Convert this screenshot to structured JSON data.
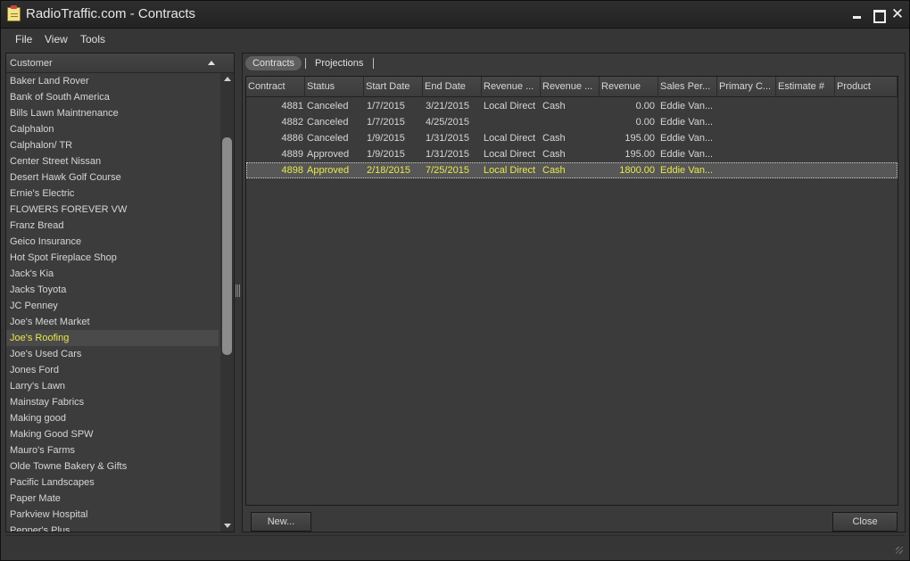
{
  "window": {
    "title": "RadioTraffic.com - Contracts"
  },
  "menu": {
    "file": "File",
    "view": "View",
    "tools": "Tools"
  },
  "customers": {
    "header": "Customer",
    "selected_index": 16,
    "items": [
      "Baker Land Rover",
      "Bank of South America",
      "Bills Lawn Maintnenance",
      "Calphalon",
      "Calphalon/ TR",
      "Center Street Nissan",
      "Desert Hawk Golf Course",
      "Ernie's Electric",
      "FLOWERS FOREVER  VW",
      "Franz Bread",
      "Geico Insurance",
      "Hot Spot Fireplace Shop",
      "Jack's Kia",
      "Jacks Toyota",
      "JC Penney",
      "Joe's Meet Market",
      "Joe's Roofing",
      "Joe's Used Cars",
      "Jones Ford",
      "Larry's Lawn",
      "Mainstay Fabrics",
      "Making good",
      "Making Good SPW",
      "Mauro's Farms",
      "Olde Towne Bakery & Gifts",
      "Pacific Landscapes",
      "Paper Mate",
      "Parkview Hospital",
      "Pepper's Plus"
    ]
  },
  "tabs": {
    "contracts": "Contracts",
    "projections": "Projections"
  },
  "grid": {
    "columns": [
      "Contract",
      "Status",
      "Start Date",
      "End Date",
      "Revenue ...",
      "Revenue ...",
      "Revenue",
      "Sales Per...",
      "Primary C...",
      "Estimate #",
      "Product"
    ],
    "selected_index": 4,
    "rows": [
      [
        "4881",
        "Canceled",
        "1/7/2015",
        "3/21/2015",
        "Local Direct",
        "Cash",
        "0.00",
        "Eddie Van...",
        "",
        "",
        ""
      ],
      [
        "4882",
        "Canceled",
        "1/7/2015",
        "4/25/2015",
        "",
        "",
        "0.00",
        "Eddie Van...",
        "",
        "",
        ""
      ],
      [
        "4886",
        "Canceled",
        "1/9/2015",
        "1/31/2015",
        "Local Direct",
        "Cash",
        "195.00",
        "Eddie Van...",
        "",
        "",
        ""
      ],
      [
        "4889",
        "Approved",
        "1/9/2015",
        "1/31/2015",
        "Local Direct",
        "Cash",
        "195.00",
        "Eddie Van...",
        "",
        "",
        ""
      ],
      [
        "4898",
        "Approved",
        "2/18/2015",
        "7/25/2015",
        "Local Direct",
        "Cash",
        "1800.00",
        "Eddie Van...",
        "",
        "",
        ""
      ]
    ]
  },
  "buttons": {
    "new": "New...",
    "close": "Close"
  },
  "colors": {
    "selected_text": "#e8e84a",
    "background": "#363636"
  }
}
